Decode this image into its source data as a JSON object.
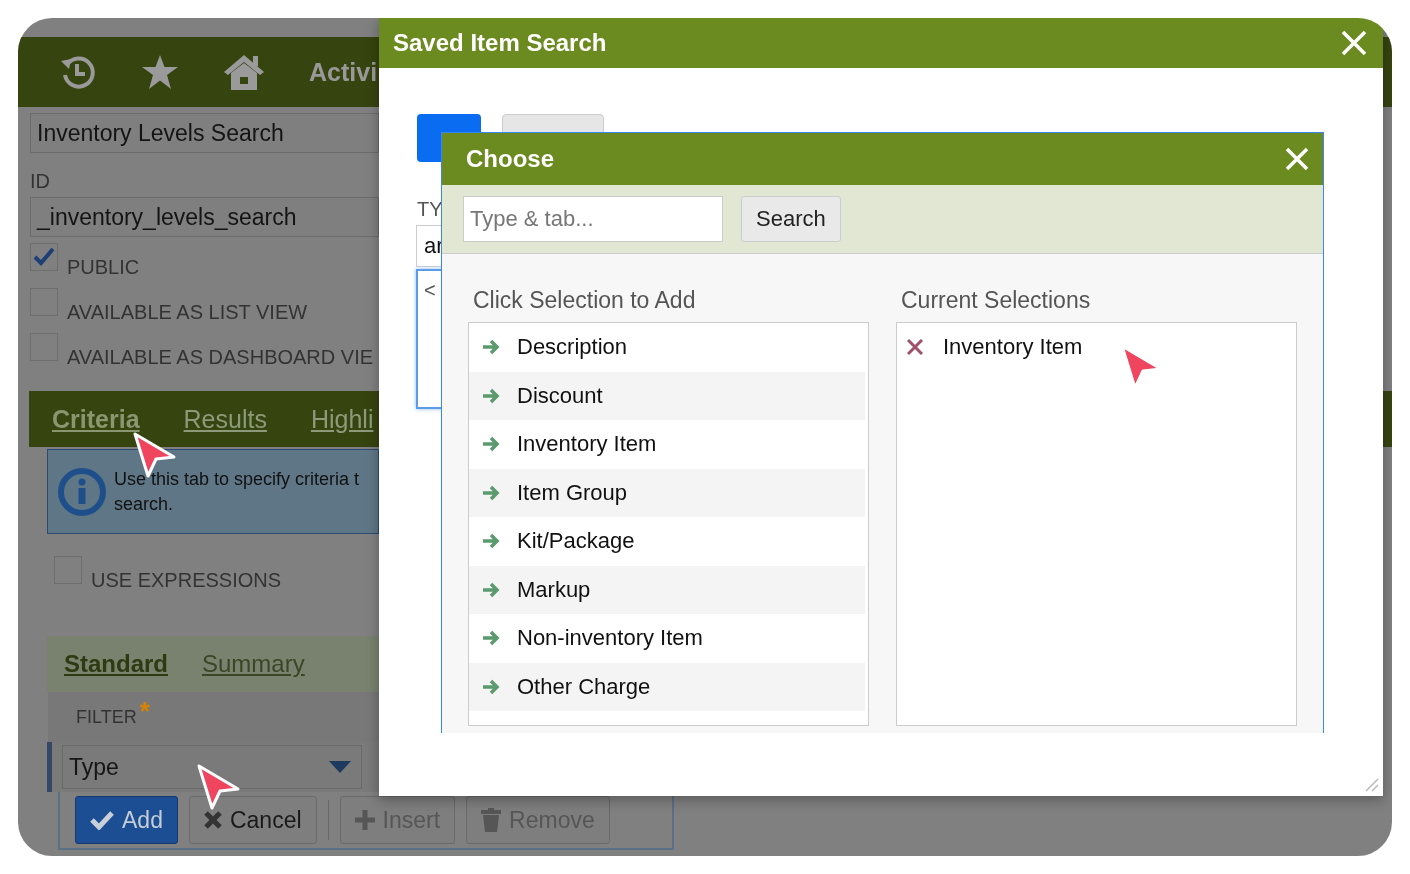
{
  "nav": {
    "label": "Activi"
  },
  "form": {
    "name": "Inventory Levels Search",
    "id_label": "ID",
    "id_value": "_inventory_levels_search",
    "options": [
      {
        "label": "PUBLIC",
        "checked": true
      },
      {
        "label": "AVAILABLE AS LIST VIEW",
        "checked": false
      },
      {
        "label": "AVAILABLE AS DASHBOARD VIE",
        "checked": false
      }
    ]
  },
  "tabs": [
    {
      "label": "Criteria",
      "selected": true
    },
    {
      "label": "Results",
      "selected": false
    },
    {
      "label": "Highli",
      "selected": false
    }
  ],
  "info": "Use this tab to specify criteria t\nsearch.",
  "use_expressions": {
    "label": "USE EXPRESSIONS",
    "checked": false
  },
  "subtabs": [
    {
      "label": "Standard",
      "selected": true
    },
    {
      "label": "Summary",
      "selected": false
    }
  ],
  "filter": {
    "label": "FILTER",
    "required_mark": "*",
    "value": "Type"
  },
  "buttons": [
    {
      "label": "Add",
      "kind": "add",
      "disabled": false
    },
    {
      "label": "Cancel",
      "kind": "cancel",
      "disabled": false
    },
    {
      "label": "Insert",
      "kind": "insert",
      "disabled": true
    },
    {
      "label": "Remove",
      "kind": "remove",
      "disabled": true
    }
  ],
  "dialog": {
    "title": "Saved Item Search",
    "type_label": "TY",
    "type_value": "ar",
    "text_value": "<"
  },
  "choose": {
    "title": "Choose",
    "search_placeholder": "Type & tab...",
    "search_button": "Search",
    "available_label": "Click Selection to Add",
    "available": [
      "Description",
      "Discount",
      "Inventory Item",
      "Item Group",
      "Kit/Package",
      "Markup",
      "Non-inventory Item",
      "Other Charge"
    ],
    "current_label": "Current Selections",
    "current": [
      "Inventory Item"
    ]
  }
}
